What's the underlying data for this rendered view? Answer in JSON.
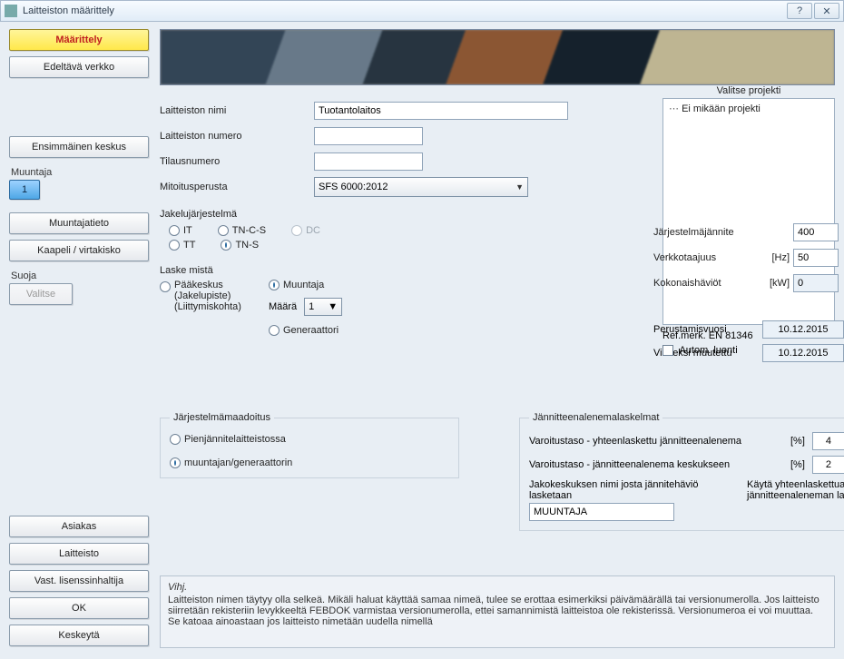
{
  "window": {
    "title": "Laitteiston määrittely"
  },
  "sidebar": {
    "define": "Määrittely",
    "prev_network": "Edeltävä verkko",
    "first_center": "Ensimmäinen keskus",
    "transformer_label": "Muuntaja",
    "transformer_num": "1",
    "transformer_info": "Muuntajatieto",
    "cable_busbar": "Kaapeli / virtakisko",
    "protection_label": "Suoja",
    "choose": "Valitse",
    "customer": "Asiakas",
    "equipment": "Laitteisto",
    "license_holder": "Vast. lisenssinhaltija",
    "ok": "OK",
    "cancel": "Keskeytä"
  },
  "project": {
    "title": "Valitse projekti",
    "none": "Ei mikään projekti"
  },
  "form": {
    "name_label": "Laitteiston nimi",
    "name_value": "Tuotantolaitos",
    "number_label": "Laitteiston numero",
    "number_value": "",
    "order_label": "Tilausnumero",
    "order_value": "",
    "basis_label": "Mitoitusperusta",
    "basis_value": "SFS 6000:2012"
  },
  "dist": {
    "label": "Jakelujärjestelmä",
    "it": "IT",
    "tncs": "TN-C-S",
    "dc": "DC",
    "tt": "TT",
    "tns": "TN-S"
  },
  "calc": {
    "label": "Laske mistä",
    "main_center": "Pääkeskus\n(Jakelupiste)\n(Liittymiskohta)",
    "transformer": "Muuntaja",
    "qty_label": "Määrä",
    "qty_value": "1",
    "generator": "Generaattori"
  },
  "sys": {
    "voltage_label": "Järjestelmäjännite",
    "voltage": "400",
    "freq_label": "Verkkotaajuus",
    "freq_unit": "[Hz]",
    "freq": "50",
    "loss_label": "Kokonaishäviöt",
    "loss_unit": "[kW]",
    "loss": "0",
    "founded_label": "Perustamisvuosi",
    "founded": "10.12.2015",
    "modified_label": "Viimeksi muutettu",
    "modified": "10.12.2015"
  },
  "ground": {
    "label": "Järjestelmämaadoitus",
    "lv": "Pienjännitelaitteistossa",
    "tg": "muuntajan/generaattorin"
  },
  "volt": {
    "label": "Jännitteenalenemalaskelmat",
    "warn_total": "Varoitustaso - yhteenlaskettu jännitteenalenema",
    "warn_center": "Varoitustaso - jännitteenalenema keskukseen",
    "pct": "[%]",
    "val_total": "4",
    "val_center": "2",
    "sub_label": "Jakokeskuksen nimi josta jännitehäviö lasketaan",
    "sub_value": "MUUNTAJA",
    "chk_label": "Käytä yhteenlaskettua virtaa jännitteenaleneman laskemisessa"
  },
  "ref": {
    "title": "Ref.merk. EN 81346",
    "auto": "Autom. luonti"
  },
  "tip": {
    "title": "Vihj.",
    "body": "Laitteiston nimen täytyy olla selkeä. Mikäli haluat käyttää samaa nimeä, tulee se erottaa esimerkiksi päivämäärällä tai versionumerolla. Jos laitteisto siirretään rekisteriin levykkeeltä FEBDOK varmistaa versionumerolla, ettei samannimistä laitteistoa ole rekisterissä. Versionumeroa ei voi muuttaa. Se katoaa ainoastaan jos laitteisto nimetään uudella nimellä"
  }
}
